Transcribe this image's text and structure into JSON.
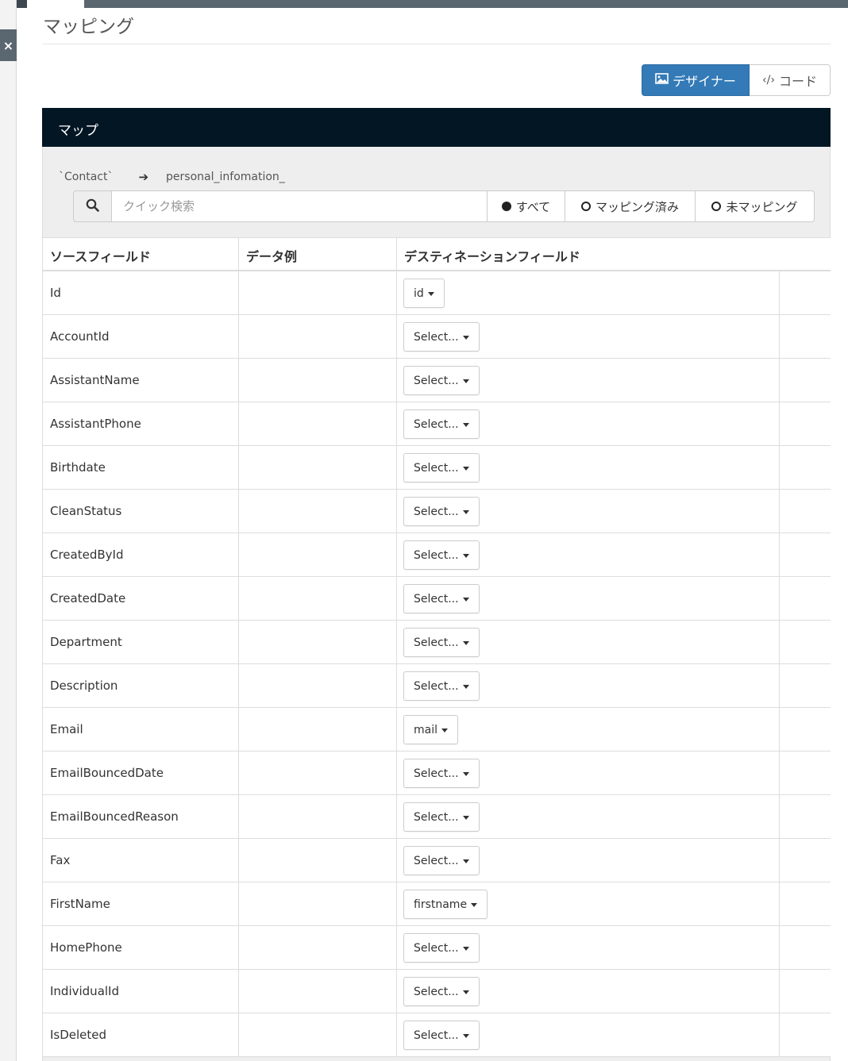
{
  "close_label": "×",
  "page_title": "マッピング",
  "view_toggle": {
    "designer_label": "デザイナー",
    "code_label": "コード"
  },
  "panel_title": "マップ",
  "route": {
    "source": "`Contact`",
    "target": "personal_infomation_"
  },
  "search": {
    "placeholder": "クイック検索",
    "value": ""
  },
  "filters": {
    "all": "すべて",
    "mapped": "マッピング済み",
    "unmapped": "未マッピング"
  },
  "table": {
    "headers": [
      "ソースフィールド",
      "データ例",
      "デスティネーションフィールド"
    ],
    "rows": [
      {
        "source": "Id",
        "example": "",
        "destination": "id"
      },
      {
        "source": "AccountId",
        "example": "",
        "destination": "Select..."
      },
      {
        "source": "AssistantName",
        "example": "",
        "destination": "Select..."
      },
      {
        "source": "AssistantPhone",
        "example": "",
        "destination": "Select..."
      },
      {
        "source": "Birthdate",
        "example": "",
        "destination": "Select..."
      },
      {
        "source": "CleanStatus",
        "example": "",
        "destination": "Select..."
      },
      {
        "source": "CreatedById",
        "example": "",
        "destination": "Select..."
      },
      {
        "source": "CreatedDate",
        "example": "",
        "destination": "Select..."
      },
      {
        "source": "Department",
        "example": "",
        "destination": "Select..."
      },
      {
        "source": "Description",
        "example": "",
        "destination": "Select..."
      },
      {
        "source": "Email",
        "example": "",
        "destination": "mail"
      },
      {
        "source": "EmailBouncedDate",
        "example": "",
        "destination": "Select..."
      },
      {
        "source": "EmailBouncedReason",
        "example": "",
        "destination": "Select..."
      },
      {
        "source": "Fax",
        "example": "",
        "destination": "Select..."
      },
      {
        "source": "FirstName",
        "example": "",
        "destination": "firstname"
      },
      {
        "source": "HomePhone",
        "example": "",
        "destination": "Select..."
      },
      {
        "source": "IndividualId",
        "example": "",
        "destination": "Select..."
      },
      {
        "source": "IsDeleted",
        "example": "",
        "destination": "Select..."
      }
    ]
  },
  "colors": {
    "primary": "#337ab7",
    "panel_header": "#031624",
    "topbar": "#5a6670"
  }
}
